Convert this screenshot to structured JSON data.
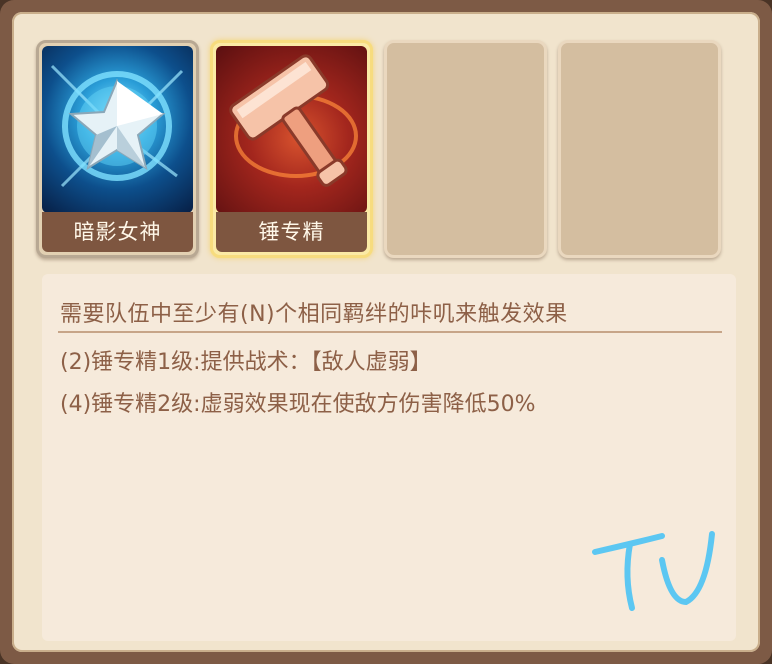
{
  "cards": [
    {
      "label": "暗影女神",
      "icon": "star-icon",
      "state": "normal"
    },
    {
      "label": "锤专精",
      "icon": "hammer-icon",
      "state": "selected"
    },
    {
      "label": "",
      "icon": "",
      "state": "empty"
    },
    {
      "label": "",
      "icon": "",
      "state": "empty"
    }
  ],
  "info": {
    "title": "需要队伍中至少有(N)个相同羁绊的咔叽来触发效果",
    "lines": [
      "(2)锤专精1级:提供战术：【敌人虚弱】",
      "(4)锤专精2级:虚弱效果现在使敌方伤害降低50%"
    ]
  },
  "colors": {
    "frame": "#7d5a45",
    "panel": "#f1e4cd",
    "label_bg": "#7e5640",
    "text": "#8d6047",
    "selected_border": "#f7dc7e"
  }
}
